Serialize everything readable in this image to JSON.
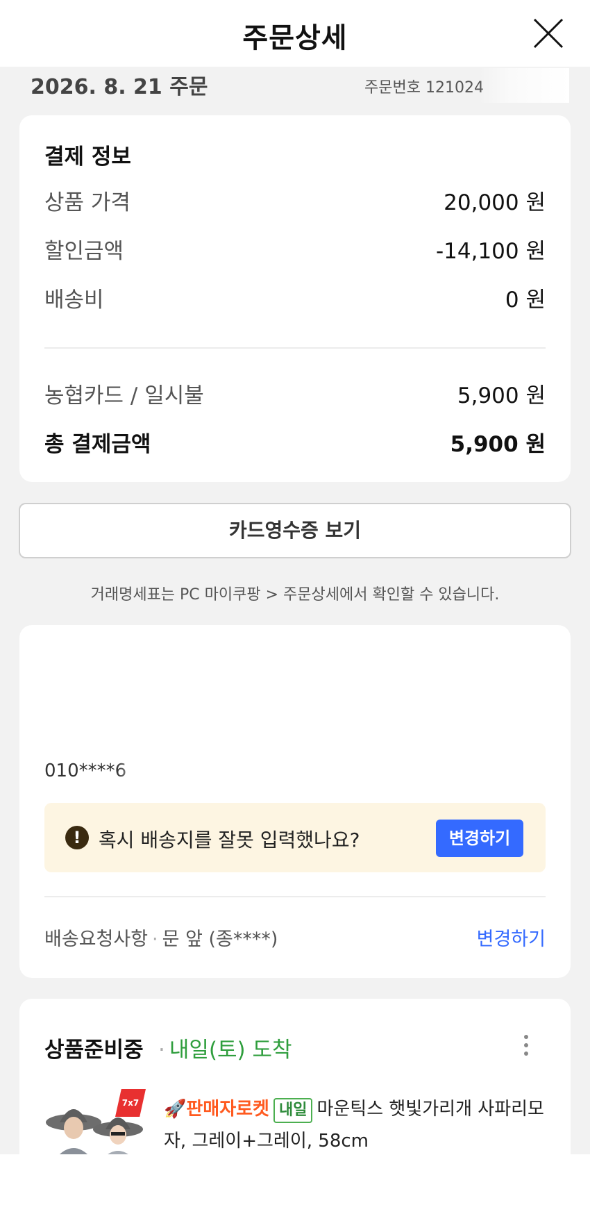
{
  "header": {
    "title": "주문상세"
  },
  "order": {
    "date": "2026. 8. 21 주문",
    "number": "주문번호 121024"
  },
  "payment": {
    "title": "결제 정보",
    "rows": [
      {
        "label": "상품 가격",
        "value": "20,000 원"
      },
      {
        "label": "할인금액",
        "value": "-14,100 원"
      },
      {
        "label": "배송비",
        "value": "0 원"
      }
    ],
    "method": {
      "label": "농협카드 / 일시불",
      "value": "5,900 원"
    },
    "total": {
      "label": "총 결제금액",
      "value": "5,900 원"
    }
  },
  "receipt_button": "카드영수증 보기",
  "note": "거래명세표는 PC 마이쿠팡 > 주문상세에서 확인할 수 있습니다.",
  "delivery": {
    "phone": "010****6",
    "warning": {
      "icon": "!",
      "text": "혹시 배송지를 잘못 입력했나요?",
      "button": "변경하기"
    },
    "request_label": "배송요청사항",
    "request_value": "문 앞 (종****)",
    "request_change": "변경하기"
  },
  "product": {
    "status": "상품준비중",
    "arrival": "내일(토) 도착",
    "badge": "7x7",
    "seller_tag": "판매자로켓",
    "delivery_tag": "내일",
    "name": "마운틱스 햇빛가리개 사파리모자, 그레이+그레이, 58cm"
  },
  "colors": {
    "accent_blue": "#346aff",
    "green": "#2f9e3d",
    "warning_bg": "#fdf5e2",
    "rocket_orange": "#ff5a1f"
  }
}
